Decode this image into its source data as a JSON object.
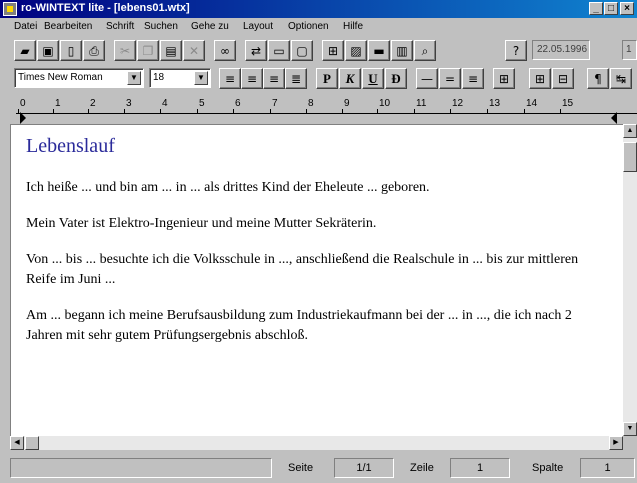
{
  "window": {
    "title": "ro-WINTEXT lite - [lebens01.wtx]",
    "controls": [
      "_",
      "□",
      "×"
    ]
  },
  "menu": {
    "items": [
      "Datei",
      "Bearbeiten",
      "Schrift",
      "Suchen",
      "Gehe zu",
      "Layout",
      "Optionen",
      "Hilfe"
    ]
  },
  "toolbar": {
    "date": "22.05.1996",
    "date_right": "1"
  },
  "format": {
    "font": "Times New Roman",
    "size": "18"
  },
  "ruler": {
    "labels": [
      "0",
      "1",
      "2",
      "3",
      "4",
      "5",
      "6",
      "7",
      "8",
      "9",
      "10",
      "11",
      "12",
      "13",
      "14",
      "15"
    ]
  },
  "document": {
    "heading": "Lebenslauf",
    "paragraphs": [
      "Ich heiße ... und bin am ... in ... als drittes Kind der Eheleute ... geboren.",
      "Mein Vater ist Elektro-Ingenieur und meine Mutter Sekräterin.",
      "Von ... bis ... besuchte ich die Volksschule in ..., anschließend die Realschule in ... bis zur mittleren Reife im Juni ...",
      "Am ... begann ich meine Berufsausbildung zum Industriekaufmann bei der ... in ..., die ich nach 2 Jahren mit sehr gutem Prüfungsergebnis abschloß."
    ]
  },
  "status": {
    "page_label": "Seite",
    "page_value": "1/1",
    "line_label": "Zeile",
    "line_value": "1",
    "col_label": "Spalte",
    "col_value": "1"
  }
}
